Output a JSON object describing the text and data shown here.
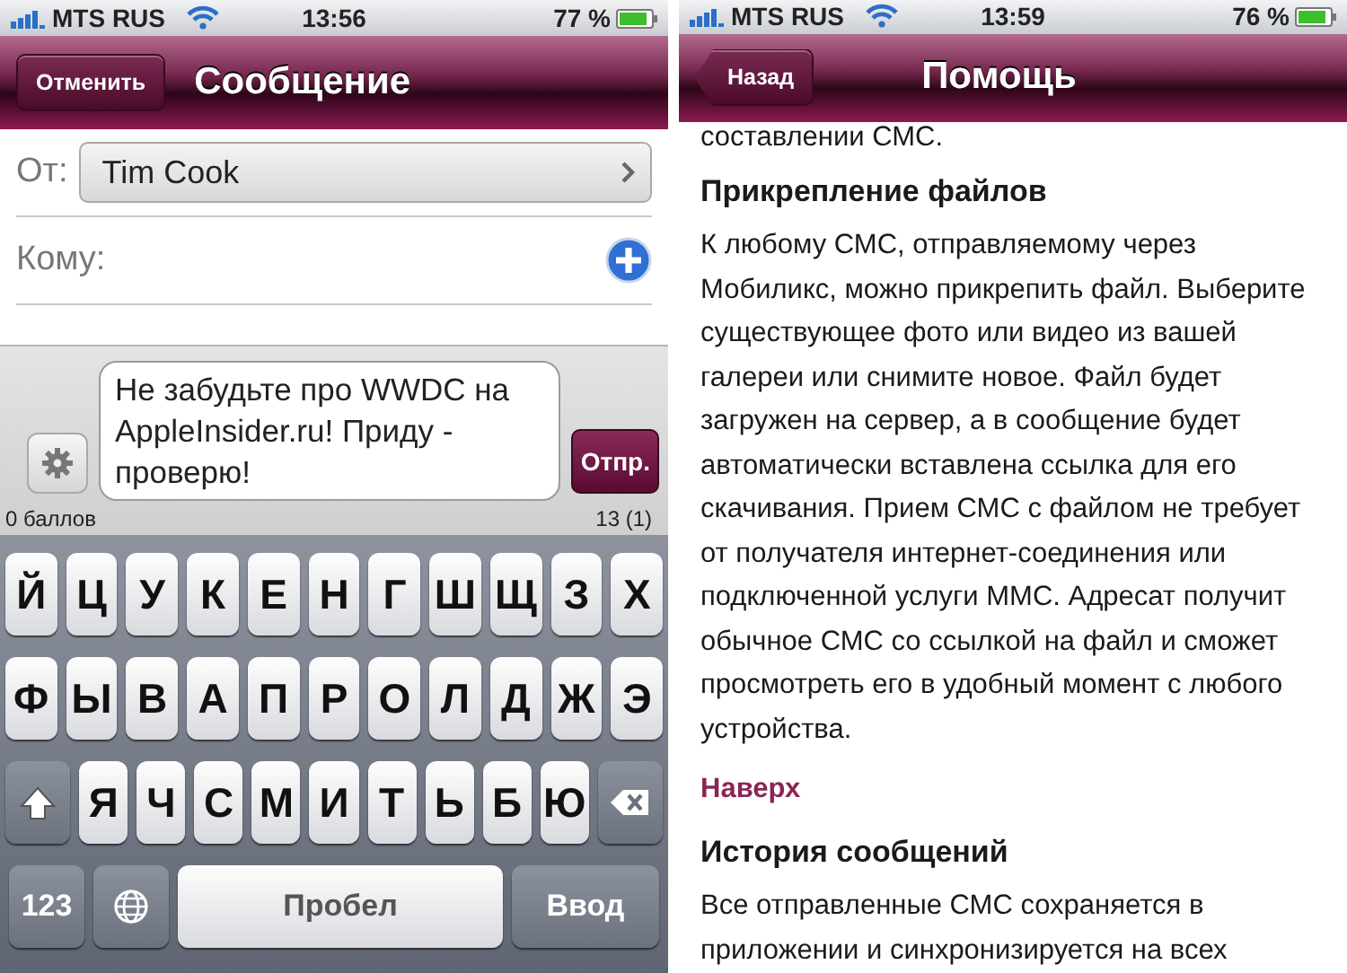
{
  "screens": [
    {
      "kind": "compose",
      "status_bar": {
        "carrier": "MTS RUS",
        "time": "13:56",
        "battery": "77 %"
      },
      "nav": {
        "kind": "plain",
        "button": "Отменить",
        "title": "Сообщение"
      },
      "from": {
        "label": "От:",
        "value": "Tim Cook"
      },
      "to": {
        "label": "Кому:"
      },
      "message": {
        "value": "Не забудьте про WWDC на AppleInsider.ru! Приду - проверю!",
        "send": "Отпр."
      },
      "counter": {
        "left": "0 баллов",
        "right": "13 (1)"
      },
      "keyboard": {
        "lines": [
          {
            "keys": [
              {
                "kind": "letter",
                "label": "Й"
              },
              {
                "kind": "letter",
                "label": "Ц"
              },
              {
                "kind": "letter",
                "label": "У"
              },
              {
                "kind": "letter",
                "label": "К"
              },
              {
                "kind": "letter",
                "label": "Е"
              },
              {
                "kind": "letter",
                "label": "Н"
              },
              {
                "kind": "letter",
                "label": "Г"
              },
              {
                "kind": "letter",
                "label": "Ш"
              },
              {
                "kind": "letter",
                "label": "Щ"
              },
              {
                "kind": "letter",
                "label": "З"
              },
              {
                "kind": "letter",
                "label": "Х"
              }
            ]
          },
          {
            "keys": [
              {
                "kind": "letter",
                "label": "Ф"
              },
              {
                "kind": "letter",
                "label": "Ы"
              },
              {
                "kind": "letter",
                "label": "В"
              },
              {
                "kind": "letter",
                "label": "А"
              },
              {
                "kind": "letter",
                "label": "П"
              },
              {
                "kind": "letter",
                "label": "Р"
              },
              {
                "kind": "letter",
                "label": "О"
              },
              {
                "kind": "letter",
                "label": "Л"
              },
              {
                "kind": "letter",
                "label": "Д"
              },
              {
                "kind": "letter",
                "label": "Ж"
              },
              {
                "kind": "letter",
                "label": "Э"
              }
            ]
          },
          {
            "keys": [
              {
                "kind": "shift"
              },
              {
                "kind": "letter",
                "label": "Я"
              },
              {
                "kind": "letter",
                "label": "Ч"
              },
              {
                "kind": "letter",
                "label": "С"
              },
              {
                "kind": "letter",
                "label": "М"
              },
              {
                "kind": "letter",
                "label": "И"
              },
              {
                "kind": "letter",
                "label": "Т"
              },
              {
                "kind": "letter",
                "label": "Ь"
              },
              {
                "kind": "letter",
                "label": "Б"
              },
              {
                "kind": "letter",
                "label": "Ю"
              },
              {
                "kind": "backspace"
              }
            ]
          },
          {
            "keys": [
              {
                "kind": "numbers",
                "label": "123"
              },
              {
                "kind": "globe"
              },
              {
                "kind": "space",
                "label": "Пробел"
              },
              {
                "kind": "return",
                "label": "Ввод"
              }
            ]
          }
        ]
      }
    },
    {
      "kind": "help",
      "status_bar": {
        "carrier": "MTS RUS",
        "time": "13:59",
        "battery": "76 %"
      },
      "nav": {
        "kind": "back",
        "button": "Назад",
        "title": "Помощь"
      },
      "content": [
        {
          "kind": "text",
          "text": "составлении СМС."
        },
        {
          "kind": "heading",
          "text": "Прикрепление файлов"
        },
        {
          "kind": "text",
          "text": "К любому СМС, отправляемому через Мобиликс, можно прикрепить файл. Выберите существующее фото или видео из вашей галереи или снимите новое. Файл будет загружен на сервер, а в сообщение будет автоматически вставлена ссылка для его скачивания. Прием СМС с файлом не требует от получателя интернет-соединения или подключенной услуги ММС. Адресат получит обычное СМС со ссылкой на файл и сможет просмотреть его в удобный момент с любого устройства."
        },
        {
          "kind": "link",
          "text": "Наверх"
        },
        {
          "kind": "heading",
          "text": "История сообщений"
        },
        {
          "kind": "text",
          "text": "Все отправленные СМС сохраняется в приложении и синхронизируется на всех"
        }
      ]
    }
  ]
}
